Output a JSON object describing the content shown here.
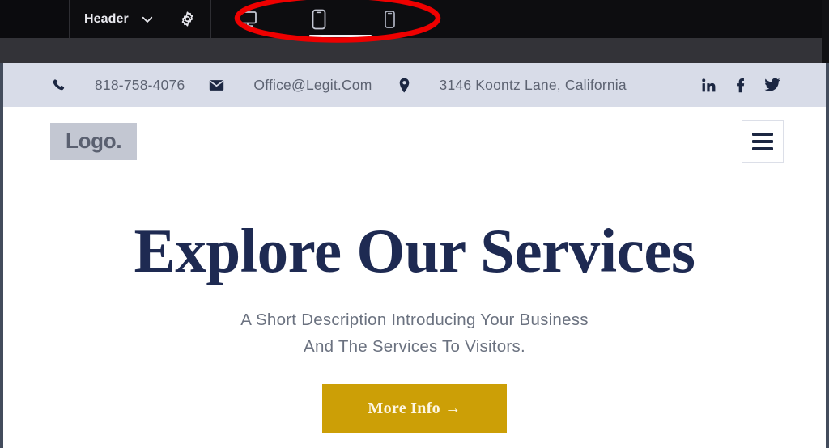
{
  "editor": {
    "section_label": "Header",
    "chevron_icon": "chevron-down-icon",
    "settings_icon": "gear-icon",
    "devices": [
      {
        "name": "desktop",
        "icon": "desktop-icon",
        "active": false
      },
      {
        "name": "tablet",
        "icon": "tablet-icon",
        "active": true
      },
      {
        "name": "mobile",
        "icon": "mobile-icon",
        "active": false
      }
    ],
    "annotation": {
      "shape": "ellipse",
      "color": "#ee0000"
    }
  },
  "site": {
    "contactbar": {
      "phone_icon": "phone-icon",
      "phone": "818-758-4076",
      "email_icon": "envelope-icon",
      "email": "Office@Legit.Com",
      "location_icon": "map-pin-icon",
      "address": "3146 Koontz Lane, California",
      "socials": [
        {
          "name": "linkedin-icon",
          "label": "in"
        },
        {
          "name": "facebook-icon",
          "label": "f"
        },
        {
          "name": "twitter-icon",
          "label": "twitter"
        }
      ]
    },
    "header": {
      "logo": "Logo.",
      "menu_icon": "hamburger-menu-icon"
    },
    "hero": {
      "title": "Explore Our Services",
      "subtitle_line1": "A Short Description Introducing Your Business",
      "subtitle_line2": "And The Services To Visitors.",
      "cta_label": "More Info →"
    }
  },
  "colors": {
    "toolbar_bg": "#0d0d10",
    "strip_bg": "#333338",
    "contactbar_bg": "#d8dce8",
    "navy": "#1c2742",
    "heading": "#1e2a52",
    "cta": "#cc9f06",
    "annotation": "#ee0000"
  }
}
